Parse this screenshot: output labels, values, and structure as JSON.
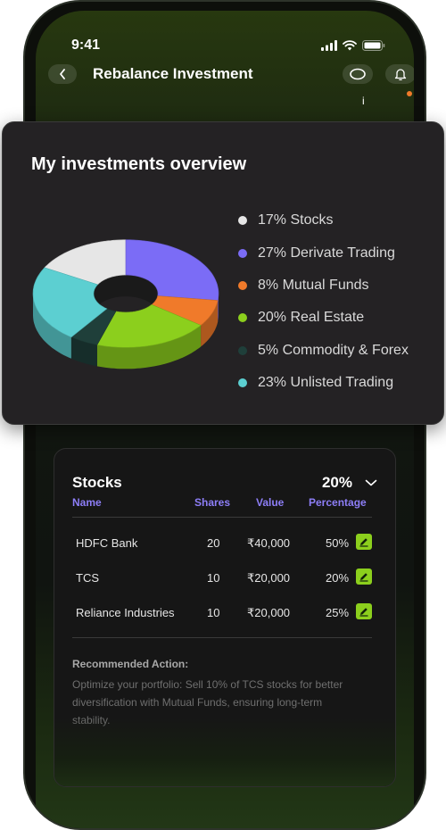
{
  "status": {
    "time": "9:41"
  },
  "nav": {
    "title": "Rebalance Investment",
    "info": "i"
  },
  "overview": {
    "title": "My investments overview",
    "legend": [
      {
        "label": "17% Stocks",
        "color": "#e6e6e6"
      },
      {
        "label": "27% Derivate Trading",
        "color": "#7b6cf6"
      },
      {
        "label": "8% Mutual Funds",
        "color": "#f07a2a"
      },
      {
        "label": "20% Real Estate",
        "color": "#8ccf1d"
      },
      {
        "label": "5% Commodity & Forex",
        "color": "#1f3f3a"
      },
      {
        "label": "23% Unlisted Trading",
        "color": "#5ccfd1"
      }
    ]
  },
  "chart_data": {
    "type": "pie",
    "categories": [
      "Stocks",
      "Derivate Trading",
      "Mutual Funds",
      "Real Estate",
      "Commodity & Forex",
      "Unlisted Trading"
    ],
    "values": [
      17,
      27,
      8,
      20,
      5,
      23
    ],
    "colors": [
      "#e6e6e6",
      "#7b6cf6",
      "#f07a2a",
      "#8ccf1d",
      "#1f3f3a",
      "#5ccfd1"
    ],
    "title": "My investments overview",
    "legend_position": "right"
  },
  "stocks": {
    "title": "Stocks",
    "percentage": "20%",
    "columns": {
      "name": "Name",
      "shares": "Shares",
      "value": "Value",
      "percentage": "Percentage"
    },
    "rows": [
      {
        "name": "HDFC Bank",
        "shares": "20",
        "value": "₹40,000",
        "percentage": "50%"
      },
      {
        "name": "TCS",
        "shares": "10",
        "value": "₹20,000",
        "percentage": "20%"
      },
      {
        "name": "Reliance Industries",
        "shares": "10",
        "value": "₹20,000",
        "percentage": "25%"
      }
    ],
    "recommended_title": "Recommended Action:",
    "recommended_text": "Optimize your portfolio: Sell 10% of TCS stocks for better diversification with Mutual Funds, ensuring long-term stability."
  }
}
